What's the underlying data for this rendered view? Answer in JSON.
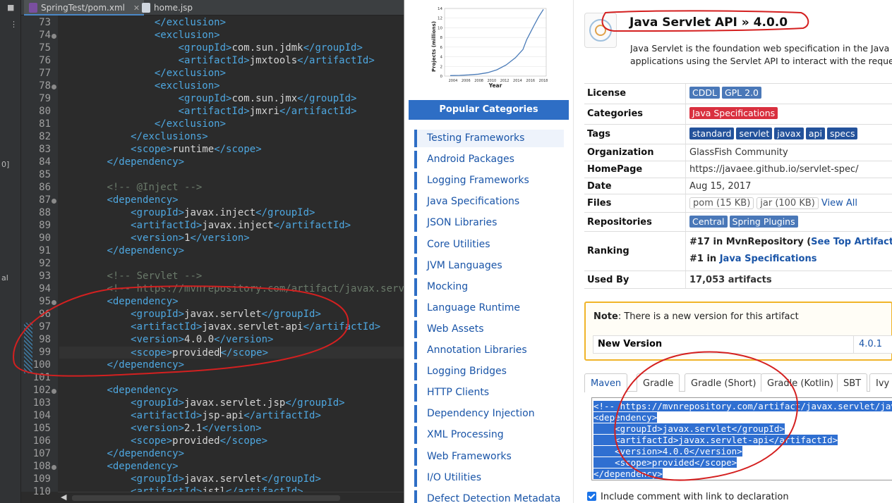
{
  "editor": {
    "tabs": [
      {
        "label": "SpringTest/pom.xml",
        "close": "✕"
      },
      {
        "label": "home.jsp"
      }
    ],
    "left_glyphs": [
      "■",
      "⋮",
      "0]",
      "al"
    ],
    "lines": [
      {
        "n": "73",
        "indent": "        ",
        "html": "<span class='tg'>&lt;/exclusion&gt;</span>"
      },
      {
        "n": "74",
        "fold": true,
        "indent": "        ",
        "html": "<span class='tg'>&lt;exclusion&gt;</span>"
      },
      {
        "n": "75",
        "indent": "            ",
        "html": "<span class='tg'>&lt;groupId&gt;</span>com.sun.jdmk<span class='tg'>&lt;/groupId&gt;</span>"
      },
      {
        "n": "76",
        "indent": "            ",
        "html": "<span class='tg'>&lt;artifactId&gt;</span>jmxtools<span class='tg'>&lt;/artifactId&gt;</span>"
      },
      {
        "n": "77",
        "indent": "        ",
        "html": "<span class='tg'>&lt;/exclusion&gt;</span>"
      },
      {
        "n": "78",
        "fold": true,
        "indent": "        ",
        "html": "<span class='tg'>&lt;exclusion&gt;</span>"
      },
      {
        "n": "79",
        "indent": "            ",
        "html": "<span class='tg'>&lt;groupId&gt;</span>com.sun.jmx<span class='tg'>&lt;/groupId&gt;</span>"
      },
      {
        "n": "80",
        "indent": "            ",
        "html": "<span class='tg'>&lt;artifactId&gt;</span>jmxri<span class='tg'>&lt;/artifactId&gt;</span>"
      },
      {
        "n": "81",
        "indent": "        ",
        "html": "<span class='tg'>&lt;/exclusion&gt;</span>"
      },
      {
        "n": "82",
        "indent": "    ",
        "html": "<span class='tg'>&lt;/exclusions&gt;</span>"
      },
      {
        "n": "83",
        "indent": "    ",
        "html": "<span class='tg'>&lt;scope&gt;</span>runtime<span class='tg'>&lt;/scope&gt;</span>"
      },
      {
        "n": "84",
        "indent": "",
        "html": "<span class='tg'>&lt;/dependency&gt;</span>"
      },
      {
        "n": "85",
        "indent": "",
        "html": ""
      },
      {
        "n": "86",
        "indent": "",
        "html": "<span class='cm'>&lt;!-- @Inject --&gt;</span>"
      },
      {
        "n": "87",
        "fold": true,
        "indent": "",
        "html": "<span class='tg'>&lt;dependency&gt;</span>"
      },
      {
        "n": "88",
        "indent": "    ",
        "html": "<span class='tg'>&lt;groupId&gt;</span>javax.inject<span class='tg'>&lt;/groupId&gt;</span>"
      },
      {
        "n": "89",
        "indent": "    ",
        "html": "<span class='tg'>&lt;artifactId&gt;</span>javax.inject<span class='tg'>&lt;/artifactId&gt;</span>"
      },
      {
        "n": "90",
        "indent": "    ",
        "html": "<span class='tg'>&lt;version&gt;</span>1<span class='tg'>&lt;/version&gt;</span>"
      },
      {
        "n": "91",
        "indent": "",
        "html": "<span class='tg'>&lt;/dependency&gt;</span>"
      },
      {
        "n": "92",
        "indent": "",
        "html": ""
      },
      {
        "n": "93",
        "indent": "",
        "html": "<span class='cm'>&lt;!-- Servlet --&gt;</span>"
      },
      {
        "n": "94",
        "indent": "",
        "html": "<span class='cm'>&lt;!-- https://mvnrepository.com/artifact/javax.servlet/javax.servlet-api --&gt;</span>"
      },
      {
        "n": "95",
        "fold": true,
        "indent": "",
        "html": "<span class='tg'>&lt;dependency&gt;</span>"
      },
      {
        "n": "96",
        "indent": "    ",
        "html": "<span class='tg'>&lt;groupId&gt;</span>javax.servlet<span class='tg'>&lt;/groupId&gt;</span>"
      },
      {
        "n": "97",
        "indent": "    ",
        "html": "<span class='tg'>&lt;artifactId&gt;</span>javax.servlet-api<span class='tg'>&lt;/artifactId&gt;</span>"
      },
      {
        "n": "98",
        "indent": "    ",
        "html": "<span class='tg'>&lt;version&gt;</span>4.0.0<span class='tg'>&lt;/version&gt;</span>"
      },
      {
        "n": "99",
        "cur": true,
        "indent": "    ",
        "html": "<span class='tg'>&lt;scope&gt;</span>provided<span class='caret'></span><span class='tg'>&lt;/scope&gt;</span>"
      },
      {
        "n": "100",
        "indent": "",
        "html": "<span class='tg'>&lt;/dependency&gt;</span>"
      },
      {
        "n": "101",
        "indent": "",
        "html": ""
      },
      {
        "n": "102",
        "fold": true,
        "indent": "",
        "html": "<span class='tg'>&lt;dependency&gt;</span>"
      },
      {
        "n": "103",
        "indent": "    ",
        "html": "<span class='tg'>&lt;groupId&gt;</span>javax.servlet.jsp<span class='tg'>&lt;/groupId&gt;</span>"
      },
      {
        "n": "104",
        "indent": "    ",
        "html": "<span class='tg'>&lt;artifactId&gt;</span>jsp-api<span class='tg'>&lt;/artifactId&gt;</span>"
      },
      {
        "n": "105",
        "indent": "    ",
        "html": "<span class='tg'>&lt;version&gt;</span>2.1<span class='tg'>&lt;/version&gt;</span>"
      },
      {
        "n": "106",
        "indent": "    ",
        "html": "<span class='tg'>&lt;scope&gt;</span>provided<span class='tg'>&lt;/scope&gt;</span>"
      },
      {
        "n": "107",
        "indent": "",
        "html": "<span class='tg'>&lt;/dependency&gt;</span>"
      },
      {
        "n": "108",
        "fold": true,
        "indent": "",
        "html": "<span class='tg'>&lt;dependency&gt;</span>"
      },
      {
        "n": "109",
        "indent": "    ",
        "html": "<span class='tg'>&lt;groupId&gt;</span>javax.servlet<span class='tg'>&lt;/groupId&gt;</span>"
      },
      {
        "n": "110",
        "indent": "    ",
        "html": "<span class='tg'>&lt;artifactId&gt;</span>jstl<span class='tg'>&lt;/artifactId&gt;</span>"
      }
    ],
    "scroll_arrow": "◀"
  },
  "mvn": {
    "chart": {
      "ylabel": "Projects (millions)",
      "xlabel": "Year",
      "yticks": [
        "0",
        "2",
        "4",
        "6",
        "8",
        "10",
        "12",
        "14"
      ],
      "xticks": [
        "2004",
        "2006",
        "2008",
        "2010",
        "2012",
        "2014",
        "2016",
        "2018"
      ]
    },
    "popular_heading": "Popular Categories",
    "categories": [
      "Testing Frameworks",
      "Android Packages",
      "Logging Frameworks",
      "Java Specifications",
      "JSON Libraries",
      "Core Utilities",
      "JVM Languages",
      "Mocking",
      "Language Runtime",
      "Web Assets",
      "Annotation Libraries",
      "Logging Bridges",
      "HTTP Clients",
      "Dependency Injection",
      "XML Processing",
      "Web Frameworks",
      "I/O Utilities",
      "Defect Detection Metadata"
    ],
    "title": "Java Servlet API » 4.0.0",
    "desc_line1": "Java Servlet is the foundation web specification in the Java Ente",
    "desc_line2": "applications using the Servlet API to interact with the request",
    "info": {
      "license_key": "License",
      "license_badges": [
        "CDDL",
        "GPL 2.0"
      ],
      "categories_key": "Categories",
      "categories_badge": "Java Specifications",
      "tags_key": "Tags",
      "tags": [
        "standard",
        "servlet",
        "javax",
        "api",
        "specs"
      ],
      "org_key": "Organization",
      "org_val": "GlassFish Community",
      "home_key": "HomePage",
      "home_val": "https://javaee.github.io/servlet-spec/",
      "date_key": "Date",
      "date_val": "Aug 15, 2017",
      "files_key": "Files",
      "files_pom": "pom (15 KB)",
      "files_jar": "jar (100 KB)",
      "files_all": "View All",
      "repos_key": "Repositories",
      "repos": [
        "Central",
        "Spring Plugins"
      ],
      "ranking_key": "Ranking",
      "ranking1_a": "#17 in MvnRepository (",
      "ranking1_link": "See Top Artifacts",
      "ranking1_b": ")",
      "ranking2_a": "#1 in ",
      "ranking2_link": "Java Specifications",
      "usedby_key": "Used By",
      "usedby_val": "17,053 artifacts"
    },
    "note_bold": "Note",
    "note_text": ": There is a new version for this artifact",
    "newver_key": "New Version",
    "newver_val": "4.0.1",
    "build_tabs": [
      "Maven",
      "Gradle",
      "Gradle (Short)",
      "Gradle (Kotlin)",
      "SBT",
      "Ivy"
    ],
    "snippet": [
      "<!-- https://mvnrepository.com/artifact/javax.servlet/javax.servlet-api -->",
      "<dependency>",
      "    <groupId>javax.servlet</groupId>",
      "    <artifactId>javax.servlet-api</artifactId>",
      "    <version>4.0.0</version>",
      "    <scope>provided</scope>",
      "</dependency>"
    ],
    "include_comment": "Include comment with link to declaration"
  },
  "colors": {
    "accent": "#2e6ec5",
    "tag": "#4ea7e0",
    "annotation": "#d42020"
  }
}
